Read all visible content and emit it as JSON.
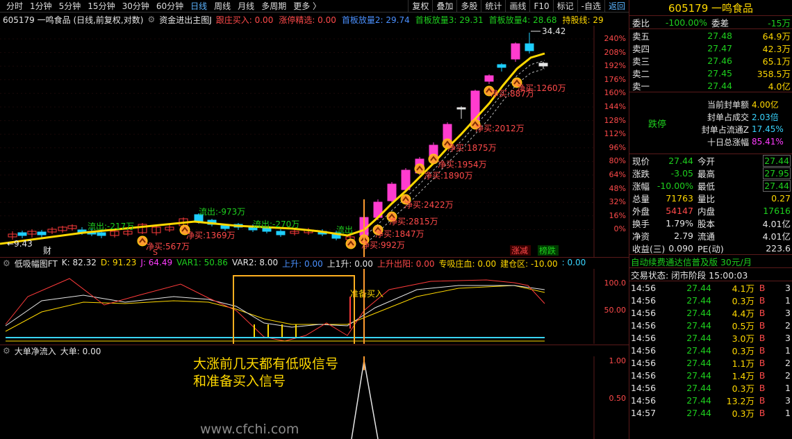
{
  "toolbar": {
    "tabs": [
      "分时",
      "1分钟",
      "5分钟",
      "15分钟",
      "30分钟",
      "60分钟",
      "日线",
      "周线",
      "月线",
      "多周期",
      "更多 〉"
    ],
    "active": "日线",
    "right": [
      "复权",
      "叠加",
      "多股",
      "统计",
      "画线",
      "F10",
      "标记",
      "-自选"
    ],
    "back": "返回"
  },
  "info": {
    "code_name": "605179 一鸣食品 (日线,前复权,对数)",
    "indicator": "资金进出主图J",
    "items": [
      {
        "t": "跟庄买入: 0.00",
        "c": "#ff4a4a"
      },
      {
        "t": "涨停精选: 0.00",
        "c": "#ff4a4a"
      },
      {
        "t": "首板放量2: 29.74",
        "c": "#4a90ff"
      },
      {
        "t": "首板放量3: 29.31",
        "c": "#1ecf1e"
      },
      {
        "t": "首板放量4: 28.68",
        "c": "#1ecf1e"
      },
      {
        "t": "持股线: 29",
        "c": "#ffd800"
      }
    ]
  },
  "main_chart": {
    "price_labels": [
      "240%",
      "208%",
      "192%",
      "176%",
      "160%",
      "144%",
      "128%",
      "112%",
      "96%",
      "80%",
      "64%",
      "48%",
      "32%",
      "16%",
      "0%"
    ],
    "high_label": "34.42",
    "low_label": "9.43",
    "annotations": [
      {
        "t": "流出:-217万",
        "c": "#1ecf1e"
      },
      {
        "t": "流出:-973万",
        "c": "#1ecf1e"
      },
      {
        "t": "流出:-270万",
        "c": "#1ecf1e"
      },
      {
        "t": "流出",
        "c": "#1ecf1e"
      },
      {
        "t": "净买:1369万",
        "c": "#ff4a4a"
      },
      {
        "t": "净买:567万",
        "c": "#ff4a4a"
      },
      {
        "t": "净买:992万",
        "c": "#ff4a4a"
      },
      {
        "t": "净买:1847万",
        "c": "#ff4a4a"
      },
      {
        "t": "净买:2815万",
        "c": "#ff4a4a"
      },
      {
        "t": "净买:2422万",
        "c": "#ff4a4a"
      },
      {
        "t": "净买:1890万",
        "c": "#ff4a4a"
      },
      {
        "t": "净买:1954万",
        "c": "#ff4a4a"
      },
      {
        "t": "净买:1875万",
        "c": "#ff4a4a"
      },
      {
        "t": "净买:2012万",
        "c": "#ff4a4a"
      },
      {
        "t": "净买:887万",
        "c": "#ff4a4a"
      },
      {
        "t": "净买:1260万",
        "c": "#ff4a4a"
      }
    ],
    "markers": {
      "cai": "财",
      "s": "S",
      "zhangjian": "涨减",
      "bangdie": "榜跌"
    }
  },
  "kdj": {
    "title": "低吸幅图FT",
    "items": [
      {
        "t": "K: 82.32",
        "c": "#e6e6e6"
      },
      {
        "t": "D: 91.23",
        "c": "#ffd800"
      },
      {
        "t": "J: 64.49",
        "c": "#ff3cff"
      },
      {
        "t": "VAR1: 50.86",
        "c": "#1ecf1e"
      },
      {
        "t": "VAR2: 8.00",
        "c": "#e6e6e6"
      },
      {
        "t": "上升: 0.00",
        "c": "#4a90ff"
      },
      {
        "t": "上1升: 0.00",
        "c": "#e6e6e6"
      },
      {
        "t": "上升出阳: 0.00",
        "c": "#ff4a4a"
      },
      {
        "t": "专吸庄血: 0.00",
        "c": "#ffd800"
      },
      {
        "t": "建仓区: -10.00",
        "c": "#ffd800"
      },
      {
        "t": ": 0.00",
        "c": "#39d5ff"
      }
    ],
    "axis": [
      "100.0",
      "50.00"
    ],
    "signal": "准备买入"
  },
  "vol": {
    "title": "大单净流入",
    "item": "大单: 0.00",
    "axis": [
      "1.00",
      "0.50"
    ]
  },
  "annotation_note": [
    "大涨前几天都有低吸信号",
    "和准备买入信号"
  ],
  "watermark": "www.cfchi.com",
  "quote": {
    "title": "605179 一鸣食品",
    "weibi": {
      "k": "委比",
      "v": "-100.00%",
      "k2": "委差",
      "v2": "-15万"
    },
    "asks": [
      {
        "k": "卖五",
        "p": "27.48",
        "v": "64.9万"
      },
      {
        "k": "卖四",
        "p": "27.47",
        "v": "42.3万"
      },
      {
        "k": "卖三",
        "p": "27.46",
        "v": "65.1万"
      },
      {
        "k": "卖二",
        "p": "27.45",
        "v": "358.5万"
      },
      {
        "k": "卖一",
        "p": "27.44",
        "v": "4.0亿"
      }
    ],
    "limit": {
      "label": "跌停",
      "rows": [
        {
          "k": "当前封单额",
          "v": "4.00亿"
        },
        {
          "k": "封单占成交",
          "v": "2.03倍"
        },
        {
          "k": "封单占流通Z",
          "v": "17.45%"
        },
        {
          "k": "十日总涨幅",
          "v": "85.41%"
        }
      ]
    },
    "stats": [
      {
        "k": "现价",
        "v": "27.44",
        "k2": "今开",
        "v2": "27.44",
        "c1": "#1ecf1e",
        "c2": "#1ecf1e"
      },
      {
        "k": "涨跌",
        "v": "-3.05",
        "k2": "最高",
        "v2": "27.95",
        "c1": "#1ecf1e",
        "c2": "#1ecf1e"
      },
      {
        "k": "涨幅",
        "v": "-10.00%",
        "k2": "最低",
        "v2": "27.44",
        "c1": "#1ecf1e",
        "c2": "#1ecf1e"
      },
      {
        "k": "总量",
        "v": "71763",
        "k2": "量比",
        "v2": "0.27",
        "c1": "#ffd800",
        "c2": "#ffd800"
      },
      {
        "k": "外盘",
        "v": "54147",
        "k2": "内盘",
        "v2": "17616",
        "c1": "#ff4a4a",
        "c2": "#1ecf1e"
      },
      {
        "k": "换手",
        "v": "1.79%",
        "k2": "股本",
        "v2": "4.01亿",
        "c1": "#e6e6e6",
        "c2": "#e6e6e6"
      },
      {
        "k": "净资",
        "v": "2.79",
        "k2": "流通",
        "v2": "4.01亿",
        "c1": "#e6e6e6",
        "c2": "#e6e6e6"
      },
      {
        "k": "收益(三)",
        "v": "0.090",
        "k2": "PE(动)",
        "v2": "223.6",
        "c1": "#e6e6e6",
        "c2": "#e6e6e6"
      }
    ],
    "promo": "自动续费通达信普及版 30元/月",
    "status": "交易状态: 闭市阶段 15:00:03",
    "trades": [
      {
        "t": "14:56",
        "p": "27.44",
        "v": "4.1万",
        "bs": "B",
        "n": "3"
      },
      {
        "t": "14:56",
        "p": "27.44",
        "v": "0.3万",
        "bs": "B",
        "n": "1"
      },
      {
        "t": "14:56",
        "p": "27.44",
        "v": "4.4万",
        "bs": "B",
        "n": "3"
      },
      {
        "t": "14:56",
        "p": "27.44",
        "v": "0.5万",
        "bs": "B",
        "n": "2"
      },
      {
        "t": "14:56",
        "p": "27.44",
        "v": "3.0万",
        "bs": "B",
        "n": "3"
      },
      {
        "t": "14:56",
        "p": "27.44",
        "v": "0.3万",
        "bs": "B",
        "n": "1"
      },
      {
        "t": "14:56",
        "p": "27.44",
        "v": "1.1万",
        "bs": "B",
        "n": "2"
      },
      {
        "t": "14:56",
        "p": "27.44",
        "v": "1.4万",
        "bs": "B",
        "n": "2"
      },
      {
        "t": "14:56",
        "p": "27.44",
        "v": "0.3万",
        "bs": "B",
        "n": "1"
      },
      {
        "t": "14:56",
        "p": "27.44",
        "v": "13.2万",
        "bs": "B",
        "n": "3"
      },
      {
        "t": "14:57",
        "p": "27.44",
        "v": "0.3万",
        "bs": "B",
        "n": "1"
      }
    ]
  }
}
